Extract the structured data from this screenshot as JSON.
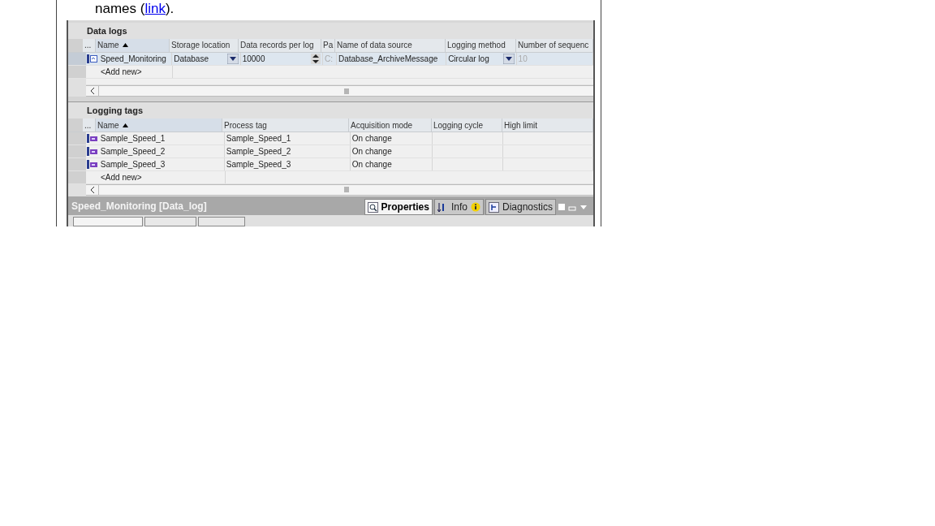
{
  "paragraph": {
    "before": "names (",
    "link": "link",
    "after": ")."
  },
  "data_logs": {
    "title": "Data logs",
    "columns": [
      {
        "label": "...",
        "sorted": false
      },
      {
        "label": "Name",
        "sorted": true
      },
      {
        "label": "Storage location",
        "sorted": false
      },
      {
        "label": "Data records per log",
        "sorted": false
      },
      {
        "label": "Pa",
        "sorted": false
      },
      {
        "label": "Name of data source",
        "sorted": false
      },
      {
        "label": "Logging method",
        "sorted": false
      },
      {
        "label": "Number of sequenc",
        "sorted": false
      }
    ],
    "rows": [
      {
        "selected": true,
        "cells": [
          {
            "kind": "log_icon"
          },
          {
            "kind": "text",
            "text": "Speed_Monitoring"
          },
          {
            "kind": "dropdown",
            "text": "Database"
          },
          {
            "kind": "spinner",
            "text": "10000"
          },
          {
            "kind": "disabled",
            "text": "C:"
          },
          {
            "kind": "text",
            "text": "Database_ArchiveMessage"
          },
          {
            "kind": "dropdown",
            "text": "Circular log"
          },
          {
            "kind": "disabled",
            "text": "10"
          }
        ]
      }
    ],
    "add_new": "<Add new>"
  },
  "logging_tags": {
    "title": "Logging tags",
    "columns": [
      {
        "label": "...",
        "sorted": false
      },
      {
        "label": "Name",
        "sorted": true
      },
      {
        "label": "Process tag",
        "sorted": false
      },
      {
        "label": "Acquisition mode",
        "sorted": false
      },
      {
        "label": "Logging cycle",
        "sorted": false
      },
      {
        "label": "High limit",
        "sorted": false
      }
    ],
    "rows": [
      {
        "selected": false,
        "cells": [
          {
            "kind": "tag_icon"
          },
          {
            "kind": "text",
            "text": "Sample_Speed_1"
          },
          {
            "kind": "text",
            "text": "Sample_Speed_1"
          },
          {
            "kind": "text",
            "text": "On change"
          },
          {
            "kind": "empty"
          },
          {
            "kind": "empty"
          }
        ]
      },
      {
        "selected": false,
        "cells": [
          {
            "kind": "tag_icon"
          },
          {
            "kind": "text",
            "text": "Sample_Speed_2"
          },
          {
            "kind": "text",
            "text": "Sample_Speed_2"
          },
          {
            "kind": "text",
            "text": "On change"
          },
          {
            "kind": "empty"
          },
          {
            "kind": "empty"
          }
        ]
      },
      {
        "selected": false,
        "cells": [
          {
            "kind": "tag_icon"
          },
          {
            "kind": "text",
            "text": "Sample_Speed_3"
          },
          {
            "kind": "text",
            "text": "Sample_Speed_3"
          },
          {
            "kind": "text",
            "text": "On change"
          },
          {
            "kind": "empty"
          },
          {
            "kind": "empty"
          }
        ]
      }
    ],
    "add_new": "<Add new>"
  },
  "inspector": {
    "title": "Speed_Monitoring [Data_log]",
    "tabs": [
      {
        "label": "Properties",
        "selected": true,
        "kind": "properties"
      },
      {
        "label": "Info",
        "selected": false,
        "kind": "info"
      },
      {
        "label": "Diagnostics",
        "selected": false,
        "kind": "diagnostics"
      }
    ]
  }
}
